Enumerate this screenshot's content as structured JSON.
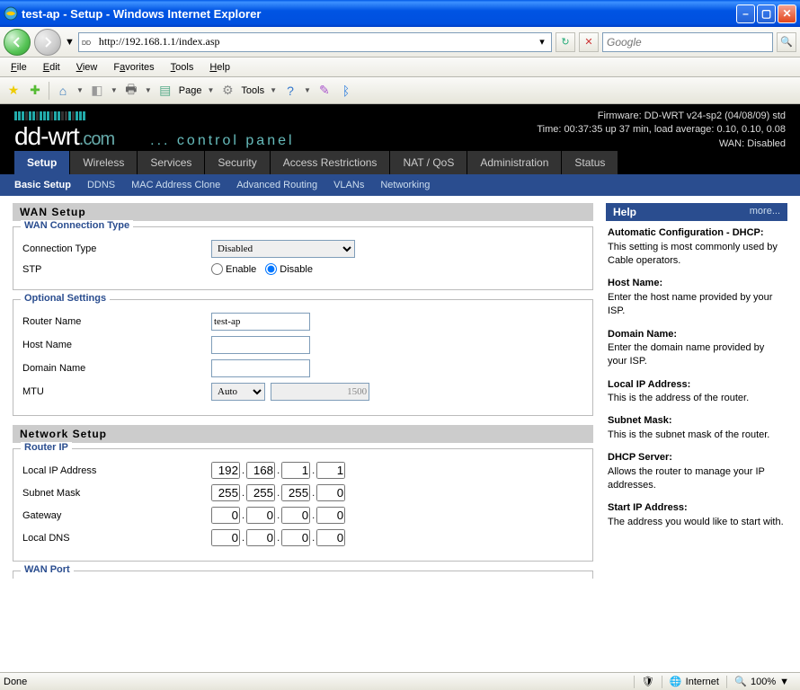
{
  "window": {
    "title": "test-ap - Setup - Windows Internet Explorer"
  },
  "address": {
    "url": "http://192.168.1.1/index.asp",
    "search_placeholder": "Google"
  },
  "menus": [
    "File",
    "Edit",
    "View",
    "Favorites",
    "Tools",
    "Help"
  ],
  "toolbar": {
    "page_label": "Page",
    "tools_label": "Tools"
  },
  "firmware": {
    "line1": "Firmware: DD-WRT v24-sp2 (04/08/09) std",
    "line2": "Time: 00:37:35 up 37 min, load average: 0.10, 0.10, 0.08",
    "line3": "WAN: Disabled"
  },
  "logo": {
    "cp": "... control panel"
  },
  "maintabs": [
    "Setup",
    "Wireless",
    "Services",
    "Security",
    "Access Restrictions",
    "NAT / QoS",
    "Administration",
    "Status"
  ],
  "subtabs": [
    "Basic Setup",
    "DDNS",
    "MAC Address Clone",
    "Advanced Routing",
    "VLANs",
    "Networking"
  ],
  "sections": {
    "wan_setup": "WAN Setup",
    "wan_conn_type": "WAN Connection Type",
    "optional": "Optional Settings",
    "network_setup": "Network Setup",
    "router_ip": "Router IP",
    "wan_port": "WAN Port"
  },
  "labels": {
    "connection_type": "Connection Type",
    "stp": "STP",
    "enable": "Enable",
    "disable": "Disable",
    "router_name": "Router Name",
    "host_name": "Host Name",
    "domain_name": "Domain Name",
    "mtu": "MTU",
    "local_ip": "Local IP Address",
    "subnet": "Subnet Mask",
    "gateway": "Gateway",
    "local_dns": "Local DNS"
  },
  "values": {
    "connection_type": "Disabled",
    "router_name": "test-ap",
    "host_name": "",
    "domain_name": "",
    "mtu_mode": "Auto",
    "mtu_value": "1500",
    "local_ip": [
      "192",
      "168",
      "1",
      "1"
    ],
    "subnet": [
      "255",
      "255",
      "255",
      "0"
    ],
    "gateway": [
      "0",
      "0",
      "0",
      "0"
    ],
    "local_dns": [
      "0",
      "0",
      "0",
      "0"
    ]
  },
  "help": {
    "title": "Help",
    "more": "more...",
    "items": [
      {
        "t": "Automatic Configuration - DHCP:",
        "d": "This setting is most commonly used by Cable operators."
      },
      {
        "t": "Host Name:",
        "d": "Enter the host name provided by your ISP."
      },
      {
        "t": "Domain Name:",
        "d": "Enter the domain name provided by your ISP."
      },
      {
        "t": "Local IP Address:",
        "d": "This is the address of the router."
      },
      {
        "t": "Subnet Mask:",
        "d": "This is the subnet mask of the router."
      },
      {
        "t": "DHCP Server:",
        "d": "Allows the router to manage your IP addresses."
      },
      {
        "t": "Start IP Address:",
        "d": "The address you would like to start with."
      }
    ]
  },
  "statusbar": {
    "left": "Done",
    "zone": "Internet",
    "zoom": "100%"
  }
}
